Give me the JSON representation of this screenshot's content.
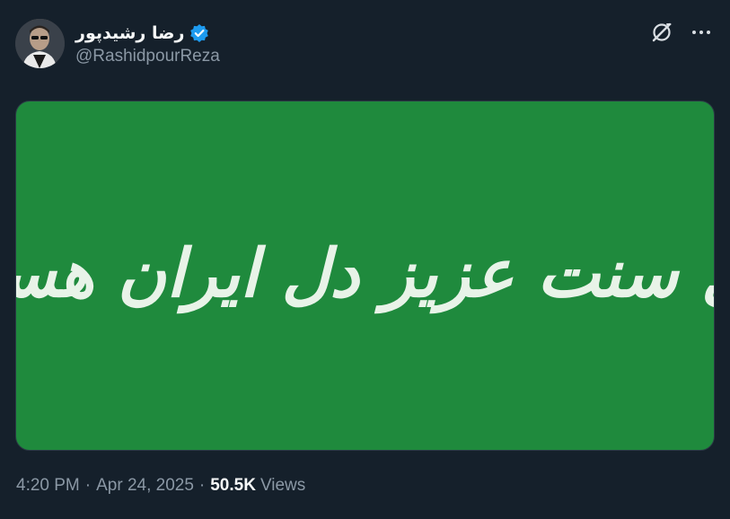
{
  "author": {
    "display_name": "رضا رشیدپور",
    "handle": "@RashidpourReza",
    "verified": true,
    "verified_color": "#1d9bf0"
  },
  "actions": {
    "grok_icon": "grok-icon",
    "more_icon": "more-icon"
  },
  "media": {
    "text": "اهل سنت عزیز دل ایران هستند",
    "background": "#1f8a3d",
    "text_color": "#e8f3e8"
  },
  "meta": {
    "time": "4:20 PM",
    "separator": "·",
    "date": "Apr 24, 2025",
    "views_count": "50.5K",
    "views_label": "Views"
  }
}
